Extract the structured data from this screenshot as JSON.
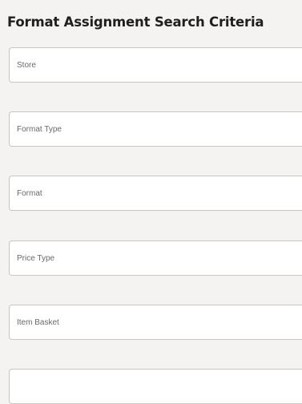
{
  "panel": {
    "title": "Format Assignment Search Criteria"
  },
  "fields": [
    {
      "placeholder": "Store"
    },
    {
      "placeholder": "Format Type"
    },
    {
      "placeholder": "Format"
    },
    {
      "placeholder": "Price Type"
    },
    {
      "placeholder": "Item Basket"
    },
    {
      "placeholder": ""
    }
  ]
}
